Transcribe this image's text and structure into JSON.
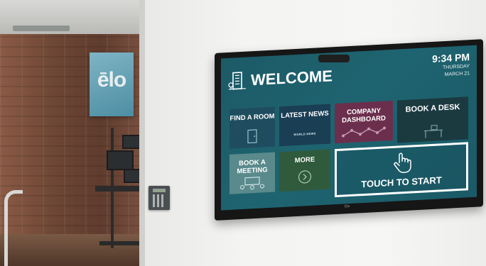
{
  "scene": {
    "logo_text": "ēlo",
    "monitor_brand": "Elo"
  },
  "kiosk": {
    "title": "WELCOME",
    "time": "9:34 PM",
    "day": "THURSDAY",
    "date": "MARCH 21",
    "tiles": [
      {
        "label": "FIND A ROOM",
        "icon": "door-icon",
        "color": "#1f4d5f"
      },
      {
        "label": "LATEST NEWS",
        "sub": "WORLD NEWS",
        "icon": "news-icon",
        "color": "#1a3e54"
      },
      {
        "label": "COMPANY DASHBOARD",
        "icon": "line-chart-icon",
        "color": "#6b2f4d"
      },
      {
        "label": "BOOK A DESK",
        "icon": "desk-icon",
        "color": "#1b3a40"
      },
      {
        "label": "BOOK A MEETING",
        "icon": "meeting-icon",
        "color": "#5a8a8c"
      },
      {
        "label": "MORE",
        "icon": "chevron-right-icon",
        "color": "#2f5a3c"
      },
      {
        "label": "TOUCH TO START",
        "icon": "hand-pointer-icon"
      }
    ]
  }
}
